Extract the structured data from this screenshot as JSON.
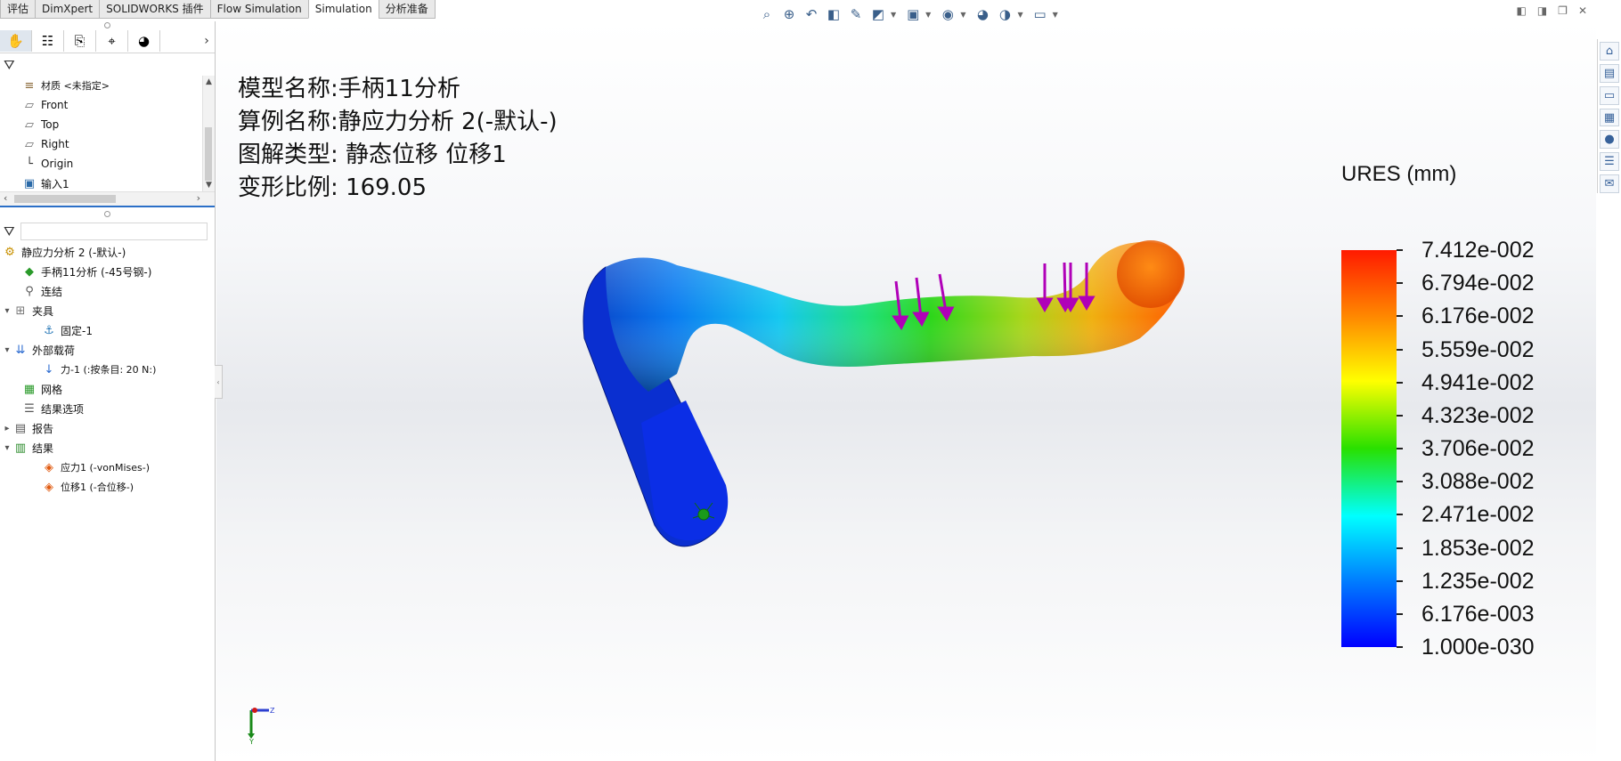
{
  "tabs": [
    {
      "label": "评估",
      "active": false
    },
    {
      "label": "DimXpert",
      "active": false
    },
    {
      "label": "SOLIDWORKS 插件",
      "active": false
    },
    {
      "label": "Flow Simulation",
      "active": false
    },
    {
      "label": "Simulation",
      "active": true
    },
    {
      "label": "分析准备",
      "active": false
    }
  ],
  "feature_tree": {
    "items": [
      {
        "label": "材质 <未指定>",
        "icon": "material-icon"
      },
      {
        "label": "Front",
        "icon": "plane-icon"
      },
      {
        "label": "Top",
        "icon": "plane-icon"
      },
      {
        "label": "Right",
        "icon": "plane-icon"
      },
      {
        "label": "Origin",
        "icon": "origin-icon"
      },
      {
        "label": "输入1",
        "icon": "imported-body-icon"
      }
    ]
  },
  "simulation_tree": {
    "study": "静应力分析 2 (-默认-)",
    "part": "手柄11分析 (-45号钢-)",
    "connections": "连结",
    "fixtures": "夹具",
    "fixed": "固定-1",
    "external_loads": "外部载荷",
    "force": "力-1 (:按条目: 20 N:)",
    "mesh": "网格",
    "result_options": "结果选项",
    "report": "报告",
    "results": "结果",
    "stress": "应力1 (-vonMises-)",
    "displacement": "位移1 (-合位移-)"
  },
  "info": {
    "model_name": "模型名称:手柄11分析",
    "study_name": "算例名称:静应力分析 2(-默认-)",
    "plot_type": "图解类型: 静态位移 位移1",
    "deformation_scale": "变形比例: 169.05"
  },
  "legend": {
    "title": "URES (mm)",
    "labels": [
      "7.412e-002",
      "6.794e-002",
      "6.176e-002",
      "5.559e-002",
      "4.941e-002",
      "4.323e-002",
      "3.706e-002",
      "3.088e-002",
      "2.471e-002",
      "1.853e-002",
      "1.235e-002",
      "6.176e-003",
      "1.000e-030"
    ],
    "colors": [
      "#ff1a00",
      "#ff8a00",
      "#ffff00",
      "#29e000",
      "#00ffff",
      "#0080ff",
      "#0000ff"
    ]
  },
  "triad": {
    "y": "Y",
    "z": "Z"
  }
}
